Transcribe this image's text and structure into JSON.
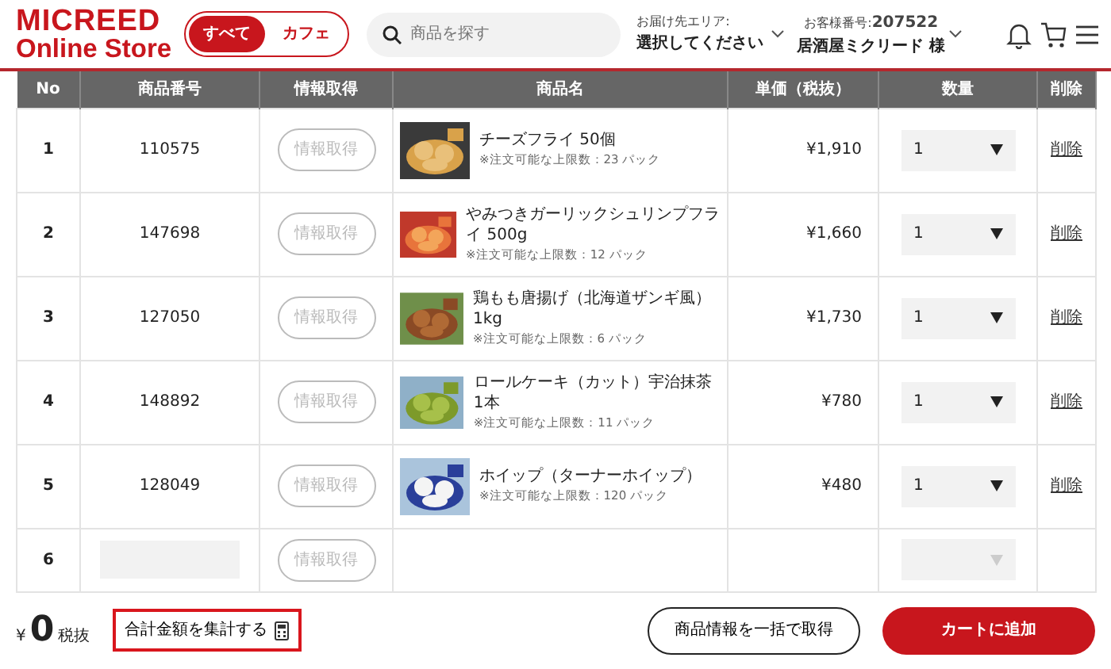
{
  "header": {
    "logo": {
      "line_1": "MICREED",
      "line_2": "Online Store"
    },
    "category_toggle": [
      {
        "label": "すべて",
        "selected": true
      },
      {
        "label": "カフェ",
        "selected": false
      }
    ],
    "search": {
      "placeholder": "商品を探す"
    },
    "delivery_area": {
      "label": "お届け先エリア:",
      "value": "選択してください"
    },
    "customer": {
      "label": "お客様番号:",
      "number": "207522",
      "name": "居酒屋ミクリード 様"
    }
  },
  "table": {
    "columns": [
      "No",
      "商品番号",
      "情報取得",
      "商品名",
      "単価（税抜）",
      "数量",
      "削除"
    ],
    "rows": [
      {
        "kind": "item",
        "no": "1",
        "code": "110575",
        "info_button": "情報取得",
        "name": "チーズフライ 50個",
        "note": "※注文可能な上限数：23 パック",
        "price": "¥1,910",
        "quantity": "1",
        "delete": "削除"
      },
      {
        "kind": "item",
        "no": "2",
        "code": "147698",
        "info_button": "情報取得",
        "name": "やみつきガーリックシュリンプフライ 500g",
        "note": "※注文可能な上限数：12 パック",
        "price": "¥1,660",
        "quantity": "1",
        "delete": "削除"
      },
      {
        "kind": "item",
        "no": "3",
        "code": "127050",
        "info_button": "情報取得",
        "name": "鶏もも唐揚げ（北海道ザンギ風） 1kg",
        "note": "※注文可能な上限数：6 パック",
        "price": "¥1,730",
        "quantity": "1",
        "delete": "削除"
      },
      {
        "kind": "item",
        "no": "4",
        "code": "148892",
        "info_button": "情報取得",
        "name": "ロールケーキ（カット）宇治抹茶 1本",
        "note": "※注文可能な上限数：11 パック",
        "price": "¥780",
        "quantity": "1",
        "delete": "削除"
      },
      {
        "kind": "item",
        "no": "5",
        "code": "128049",
        "info_button": "情報取得",
        "name": "ホイップ（ターナーホイップ）",
        "note": "※注文可能な上限数：120 パック",
        "price": "¥480",
        "quantity": "1",
        "delete": "削除"
      },
      {
        "kind": "empty",
        "no": "6",
        "info_button": "情報取得"
      }
    ]
  },
  "footer": {
    "currency": "¥",
    "total": "0",
    "tax_note": "税抜",
    "calculate_button": "合計金額を集計する",
    "fetch_all_button": "商品情報を一括で取得",
    "add_to_cart_button": "カートに追加"
  }
}
